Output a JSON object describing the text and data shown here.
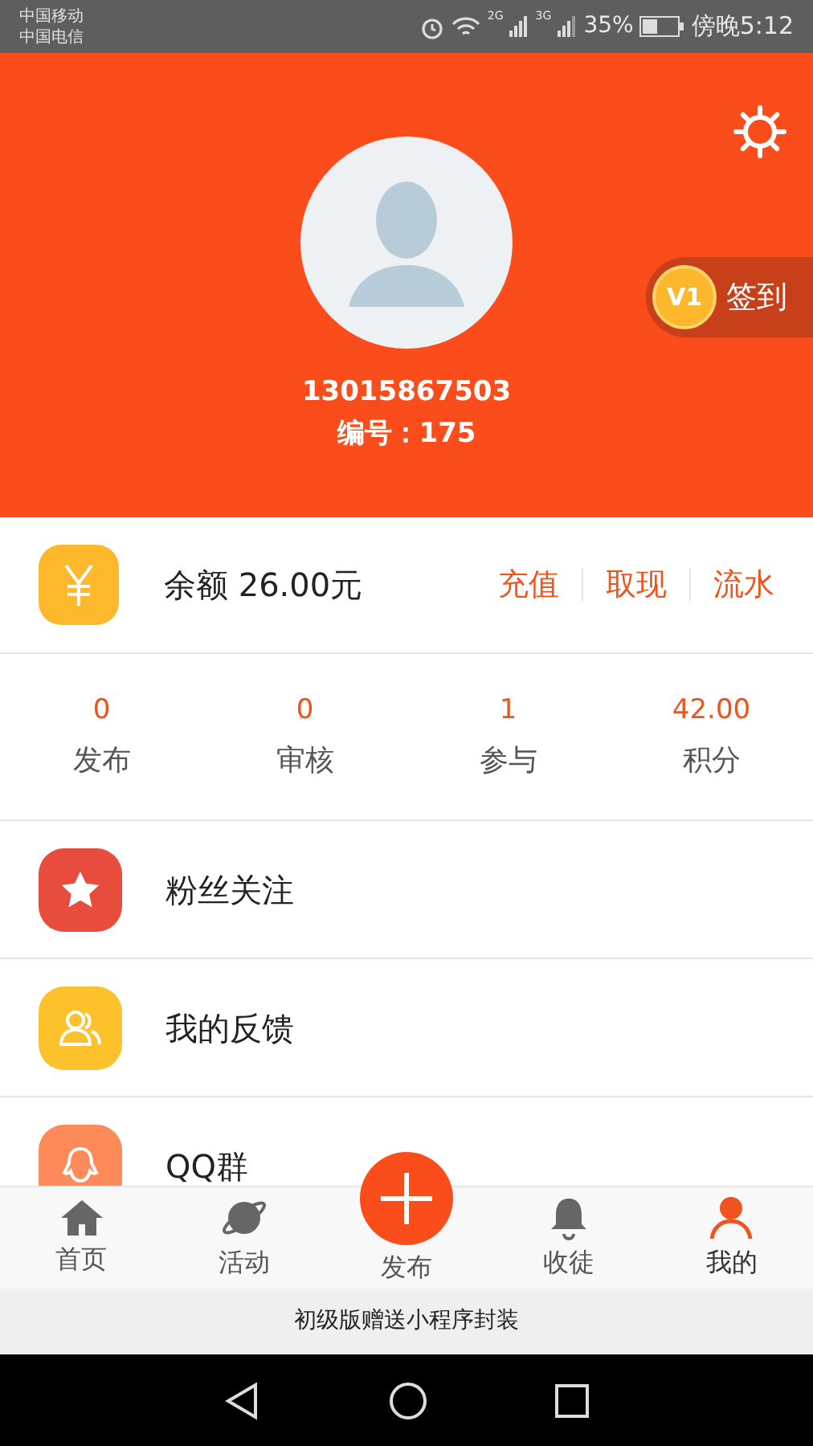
{
  "status_bar": {
    "carriers": [
      "中国移动",
      "中国电信"
    ],
    "net_1": "2G",
    "net_2": "3G",
    "battery": "35%",
    "time": "傍晚5:12"
  },
  "profile": {
    "phone": "13015867503",
    "id_label": "编号：175",
    "level": "V1",
    "sign_in": "签到"
  },
  "balance": {
    "label": "余额 26.00元",
    "actions": [
      "充值",
      "取现",
      "流水"
    ]
  },
  "stats": [
    {
      "value": "0",
      "label": "发布"
    },
    {
      "value": "0",
      "label": "审核"
    },
    {
      "value": "1",
      "label": "参与"
    },
    {
      "value": "42.00",
      "label": "积分"
    }
  ],
  "menu": [
    {
      "kind": "star",
      "label": "粉丝关注"
    },
    {
      "kind": "people",
      "label": "我的反馈"
    },
    {
      "kind": "qq",
      "label": "QQ群"
    }
  ],
  "tabs": [
    {
      "kind": "home",
      "label": "首页",
      "selected": false
    },
    {
      "kind": "planet",
      "label": "活动",
      "selected": false
    },
    {
      "kind": "publish",
      "label": "发布",
      "selected": false
    },
    {
      "kind": "bell",
      "label": "收徒",
      "selected": false
    },
    {
      "kind": "person",
      "label": "我的",
      "selected": true
    }
  ],
  "banner": "初级版赠送小程序封装"
}
